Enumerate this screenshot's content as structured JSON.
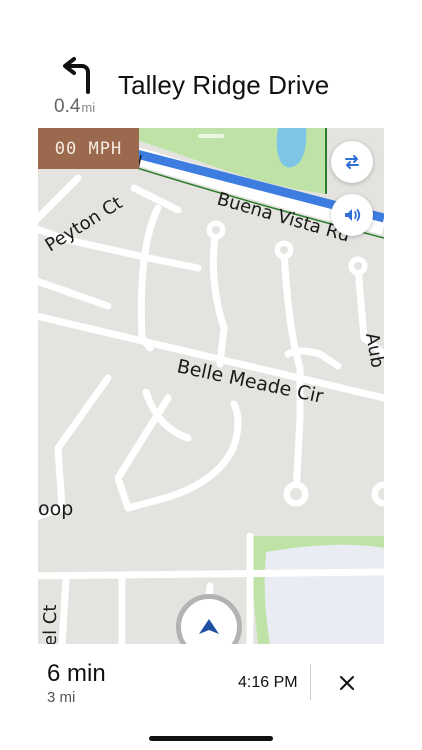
{
  "navigation": {
    "turn_icon": "turn-left-icon",
    "distance_value": "0.4",
    "distance_unit": "mi",
    "street_name": "Talley Ridge Drive"
  },
  "map": {
    "speed_readout": "00 MPH",
    "route_button_icon": "route-options-icon",
    "sound_button_icon": "volume-icon",
    "position_icon": "navigation-arrow-icon",
    "labels": {
      "peyton": "Peyton Ct",
      "buena": "Buena Vista Rd",
      "fragment_d": "d",
      "belle": "Belle Meade Cir",
      "aub": "Aub",
      "loop": "oop",
      "el_ct": "el Ct"
    },
    "colors": {
      "route": "#3d7de0",
      "park": "#bfe3a6",
      "water": "#7fc6e6",
      "road": "#ffffff",
      "land": "#e4e3e0"
    }
  },
  "trip": {
    "eta_time": "6 min",
    "remaining_distance": "3 mi",
    "arrival_time": "4:16 PM",
    "close_icon": "close-icon"
  }
}
